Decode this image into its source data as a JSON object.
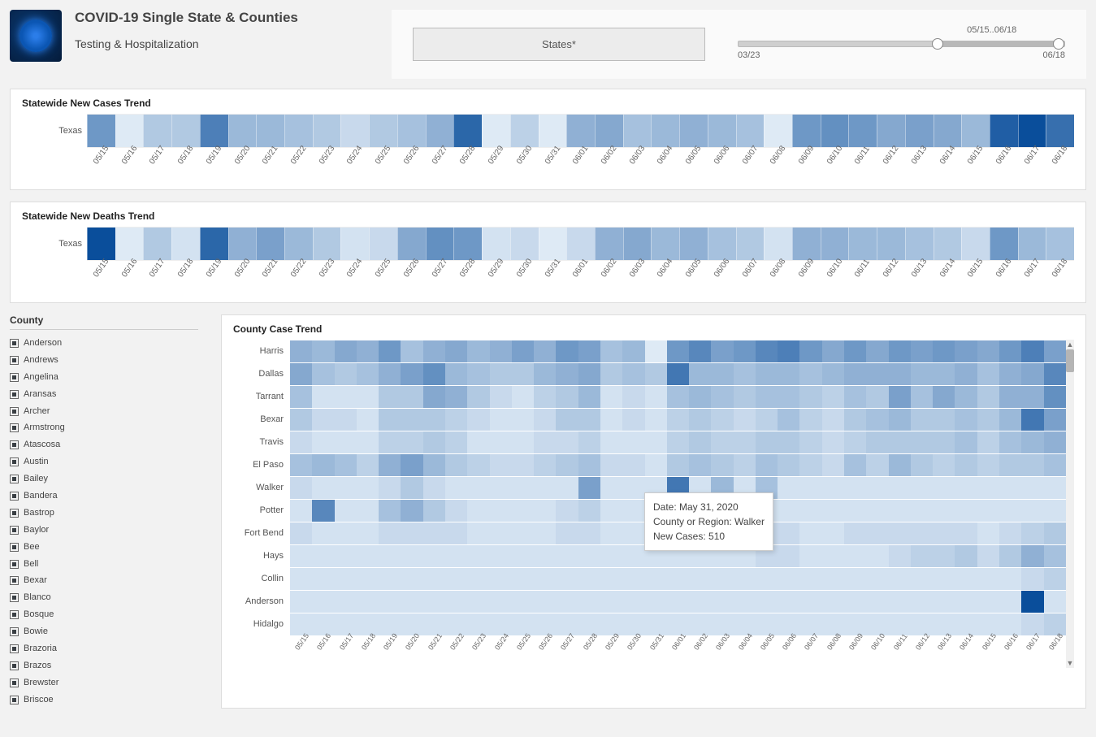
{
  "header": {
    "title": "COVID-19 Single State & Counties",
    "subtitle": "Testing & Hospitalization",
    "states_button": "States*",
    "slider": {
      "start_label": "03/23",
      "end_label": "06/18",
      "sel_label": "05/15..06/18"
    }
  },
  "panels": {
    "cases_title": "Statewide New Cases Trend",
    "deaths_title": "Statewide New Deaths Trend",
    "county_title": "County Case Trend",
    "row_label": "Texas"
  },
  "dates": [
    "05/15",
    "05/16",
    "05/17",
    "05/18",
    "05/19",
    "05/20",
    "05/21",
    "05/22",
    "05/23",
    "05/24",
    "05/25",
    "05/26",
    "05/27",
    "05/28",
    "05/29",
    "05/30",
    "05/31",
    "06/01",
    "06/02",
    "06/03",
    "06/04",
    "06/05",
    "06/06",
    "06/07",
    "06/08",
    "06/09",
    "06/10",
    "06/11",
    "06/12",
    "06/13",
    "06/14",
    "06/15",
    "06/16",
    "06/17",
    "06/18"
  ],
  "county_filter_title": "County",
  "county_filter": [
    "Anderson",
    "Andrews",
    "Angelina",
    "Aransas",
    "Archer",
    "Armstrong",
    "Atascosa",
    "Austin",
    "Bailey",
    "Bandera",
    "Bastrop",
    "Baylor",
    "Bee",
    "Bell",
    "Bexar",
    "Blanco",
    "Bosque",
    "Bowie",
    "Brazoria",
    "Brazos",
    "Brewster",
    "Briscoe"
  ],
  "county_rows": [
    "Harris",
    "Dallas",
    "Tarrant",
    "Bexar",
    "Travis",
    "El Paso",
    "Walker",
    "Potter",
    "Fort Bend",
    "Hays",
    "Collin",
    "Anderson",
    "Hidalgo"
  ],
  "tooltip": {
    "l1": "Date: May 31, 2020",
    "l2": "County or Region: Walker",
    "l3": "New Cases:  510"
  },
  "chart_data": [
    {
      "type": "heatmap",
      "title": "Statewide New Cases Trend",
      "y": [
        "Texas"
      ],
      "x": [
        "05/15",
        "05/16",
        "05/17",
        "05/18",
        "05/19",
        "05/20",
        "05/21",
        "05/22",
        "05/23",
        "05/24",
        "05/25",
        "05/26",
        "05/27",
        "05/28",
        "05/29",
        "05/30",
        "05/31",
        "06/01",
        "06/02",
        "06/03",
        "06/04",
        "06/05",
        "06/06",
        "06/07",
        "06/08",
        "06/09",
        "06/10",
        "06/11",
        "06/12",
        "06/13",
        "06/14",
        "06/15",
        "06/16",
        "06/17",
        "06/18"
      ],
      "intensity": [
        [
          55,
          5,
          25,
          25,
          70,
          35,
          35,
          30,
          25,
          15,
          25,
          30,
          40,
          85,
          5,
          20,
          5,
          40,
          45,
          30,
          35,
          40,
          35,
          30,
          5,
          55,
          60,
          55,
          45,
          50,
          45,
          35,
          90,
          100,
          80
        ]
      ],
      "color_scale": "blues",
      "note": "intensity 0-100 estimated from cell shading; higher = darker blue"
    },
    {
      "type": "heatmap",
      "title": "Statewide New Deaths Trend",
      "y": [
        "Texas"
      ],
      "x": [
        "05/15",
        "05/16",
        "05/17",
        "05/18",
        "05/19",
        "05/20",
        "05/21",
        "05/22",
        "05/23",
        "05/24",
        "05/25",
        "05/26",
        "05/27",
        "05/28",
        "05/29",
        "05/30",
        "05/31",
        "06/01",
        "06/02",
        "06/03",
        "06/04",
        "06/05",
        "06/06",
        "06/07",
        "06/08",
        "06/09",
        "06/10",
        "06/11",
        "06/12",
        "06/13",
        "06/14",
        "06/15",
        "06/16",
        "06/17",
        "06/18"
      ],
      "intensity": [
        [
          100,
          5,
          25,
          10,
          85,
          40,
          50,
          35,
          25,
          10,
          15,
          45,
          60,
          55,
          10,
          15,
          5,
          15,
          40,
          45,
          35,
          40,
          30,
          25,
          10,
          40,
          40,
          35,
          35,
          30,
          25,
          15,
          55,
          35,
          30
        ]
      ],
      "color_scale": "blues"
    },
    {
      "type": "heatmap",
      "title": "County Case Trend",
      "x": [
        "05/15",
        "05/16",
        "05/17",
        "05/18",
        "05/19",
        "05/20",
        "05/21",
        "05/22",
        "05/23",
        "05/24",
        "05/25",
        "05/26",
        "05/27",
        "05/28",
        "05/29",
        "05/30",
        "05/31",
        "06/01",
        "06/02",
        "06/03",
        "06/04",
        "06/05",
        "06/06",
        "06/07",
        "06/08",
        "06/09",
        "06/10",
        "06/11",
        "06/12",
        "06/13",
        "06/14",
        "06/15",
        "06/16",
        "06/17",
        "06/18"
      ],
      "y": [
        "Harris",
        "Dallas",
        "Tarrant",
        "Bexar",
        "Travis",
        "El Paso",
        "Walker",
        "Potter",
        "Fort Bend",
        "Hays",
        "Collin",
        "Anderson",
        "Hidalgo"
      ],
      "intensity": [
        [
          40,
          35,
          45,
          40,
          55,
          30,
          40,
          45,
          35,
          40,
          50,
          40,
          55,
          50,
          30,
          35,
          5,
          55,
          65,
          50,
          55,
          65,
          70,
          55,
          45,
          55,
          45,
          55,
          50,
          55,
          50,
          45,
          55,
          70,
          50
        ],
        [
          45,
          30,
          25,
          30,
          40,
          50,
          60,
          35,
          30,
          25,
          25,
          35,
          40,
          45,
          25,
          30,
          25,
          75,
          35,
          35,
          30,
          35,
          35,
          30,
          35,
          40,
          40,
          40,
          35,
          35,
          40,
          30,
          40,
          45,
          65
        ],
        [
          30,
          10,
          10,
          10,
          25,
          25,
          45,
          40,
          25,
          15,
          10,
          20,
          25,
          35,
          10,
          15,
          10,
          30,
          35,
          30,
          25,
          30,
          30,
          25,
          20,
          30,
          25,
          50,
          30,
          45,
          35,
          25,
          40,
          40,
          60
        ],
        [
          25,
          15,
          15,
          10,
          25,
          25,
          25,
          20,
          15,
          10,
          10,
          15,
          25,
          25,
          10,
          15,
          10,
          20,
          25,
          20,
          15,
          20,
          30,
          20,
          15,
          25,
          30,
          35,
          25,
          25,
          30,
          25,
          35,
          75,
          50
        ],
        [
          15,
          10,
          10,
          10,
          20,
          20,
          25,
          20,
          10,
          10,
          10,
          15,
          15,
          20,
          10,
          10,
          10,
          20,
          25,
          20,
          20,
          25,
          25,
          20,
          15,
          20,
          25,
          25,
          25,
          25,
          30,
          20,
          30,
          35,
          40
        ],
        [
          30,
          35,
          30,
          20,
          40,
          50,
          35,
          25,
          20,
          15,
          15,
          20,
          25,
          30,
          15,
          15,
          10,
          25,
          30,
          25,
          20,
          30,
          25,
          20,
          15,
          30,
          20,
          35,
          25,
          20,
          25,
          20,
          25,
          25,
          30
        ],
        [
          15,
          10,
          10,
          10,
          15,
          25,
          15,
          10,
          10,
          10,
          10,
          10,
          10,
          50,
          10,
          10,
          10,
          75,
          10,
          35,
          10,
          30,
          10,
          10,
          10,
          10,
          10,
          10,
          10,
          10,
          10,
          10,
          10,
          10,
          10
        ],
        [
          10,
          65,
          10,
          10,
          30,
          40,
          25,
          15,
          10,
          10,
          10,
          10,
          15,
          20,
          10,
          10,
          10,
          10,
          10,
          10,
          10,
          10,
          10,
          10,
          10,
          10,
          10,
          10,
          10,
          10,
          10,
          10,
          10,
          10,
          10
        ],
        [
          15,
          10,
          10,
          10,
          15,
          15,
          15,
          15,
          10,
          10,
          10,
          10,
          15,
          15,
          10,
          10,
          10,
          15,
          15,
          15,
          10,
          15,
          15,
          10,
          10,
          15,
          15,
          15,
          15,
          15,
          15,
          10,
          15,
          20,
          25
        ],
        [
          10,
          10,
          10,
          10,
          10,
          10,
          10,
          10,
          10,
          10,
          10,
          10,
          10,
          10,
          10,
          10,
          10,
          10,
          10,
          10,
          10,
          15,
          15,
          10,
          10,
          10,
          10,
          15,
          20,
          20,
          25,
          15,
          25,
          40,
          30
        ],
        [
          10,
          10,
          10,
          10,
          10,
          10,
          10,
          10,
          10,
          10,
          10,
          10,
          10,
          10,
          10,
          10,
          10,
          10,
          10,
          10,
          10,
          10,
          10,
          10,
          10,
          10,
          10,
          10,
          10,
          10,
          10,
          10,
          10,
          15,
          20
        ],
        [
          10,
          10,
          10,
          10,
          10,
          10,
          10,
          10,
          10,
          10,
          10,
          10,
          10,
          10,
          10,
          10,
          10,
          10,
          10,
          10,
          10,
          10,
          10,
          10,
          10,
          10,
          10,
          10,
          10,
          10,
          10,
          10,
          10,
          100,
          10
        ],
        [
          10,
          10,
          10,
          10,
          10,
          10,
          10,
          10,
          10,
          10,
          10,
          10,
          10,
          10,
          10,
          10,
          10,
          10,
          10,
          10,
          10,
          10,
          10,
          10,
          10,
          10,
          10,
          10,
          10,
          10,
          10,
          10,
          10,
          15,
          20
        ]
      ],
      "color_scale": "blues",
      "tooltip_sample": {
        "x": "05/31",
        "y": "Walker",
        "value": 510,
        "display": "New Cases: 510"
      }
    }
  ]
}
